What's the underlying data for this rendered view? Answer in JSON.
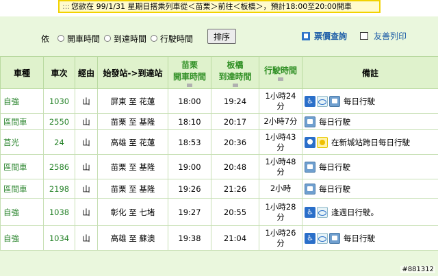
{
  "banner": {
    "dots": ":::",
    "text": "您欲在 99/1/31  星期日搭乘列車從＜苗栗＞前往＜板橋＞，預計18:00至20:00開車"
  },
  "toolbar": {
    "prefix": "依",
    "options": [
      "開車時間",
      "到達時間",
      "行駛時間"
    ],
    "sort_label": "排序",
    "fare_label": "票價查詢",
    "print_label": "友善列印"
  },
  "table": {
    "headers": {
      "type": "車種",
      "train_no": "車次",
      "via": "經由",
      "route": "始發站->到達站",
      "dep_station": "苗栗",
      "dep_label": "開車時間",
      "arr_station": "板橋",
      "arr_label": "到達時間",
      "duration": "行駛時間",
      "note": "備註"
    },
    "rows": [
      {
        "type": "自強",
        "no": "1030",
        "via": "山",
        "route": "屏東 至 花蓮",
        "dep": "18:00",
        "arr": "19:24",
        "dur1": "1小時24",
        "dur2": "分",
        "note": "每日行駛"
      },
      {
        "type": "區間車",
        "no": "2550",
        "via": "山",
        "route": "苗栗 至 基隆",
        "dep": "18:10",
        "arr": "20:17",
        "dur1": "2小時7分",
        "dur2": "",
        "note": "每日行駛"
      },
      {
        "type": "莒光",
        "no": "24",
        "via": "山",
        "route": "高雄 至 花蓮",
        "dep": "18:53",
        "arr": "20:36",
        "dur1": "1小時43",
        "dur2": "分",
        "note": "在新城站跨日每日行駛"
      },
      {
        "type": "區間車",
        "no": "2586",
        "via": "山",
        "route": "苗栗 至 基隆",
        "dep": "19:00",
        "arr": "20:48",
        "dur1": "1小時48",
        "dur2": "分",
        "note": "每日行駛"
      },
      {
        "type": "區間車",
        "no": "2198",
        "via": "山",
        "route": "苗栗 至 基隆",
        "dep": "19:26",
        "arr": "21:26",
        "dur1": "2小時",
        "dur2": "",
        "note": "每日行駛"
      },
      {
        "type": "自強",
        "no": "1038",
        "via": "山",
        "route": "彰化 至 七堵",
        "dep": "19:27",
        "arr": "20:55",
        "dur1": "1小時28",
        "dur2": "分",
        "note": "逢週日行駛。"
      },
      {
        "type": "自強",
        "no": "1034",
        "via": "山",
        "route": "高雄 至 蘇澳",
        "dep": "19:38",
        "arr": "21:04",
        "dur1": "1小時26",
        "dur2": "分",
        "note": "每日行駛"
      }
    ]
  },
  "watermark": "#881312",
  "colors": {
    "accent_green": "#27832a",
    "panel_bg": "#eaf7dd",
    "banner_border": "#f2d200",
    "link_blue": "#1e5ea8"
  }
}
